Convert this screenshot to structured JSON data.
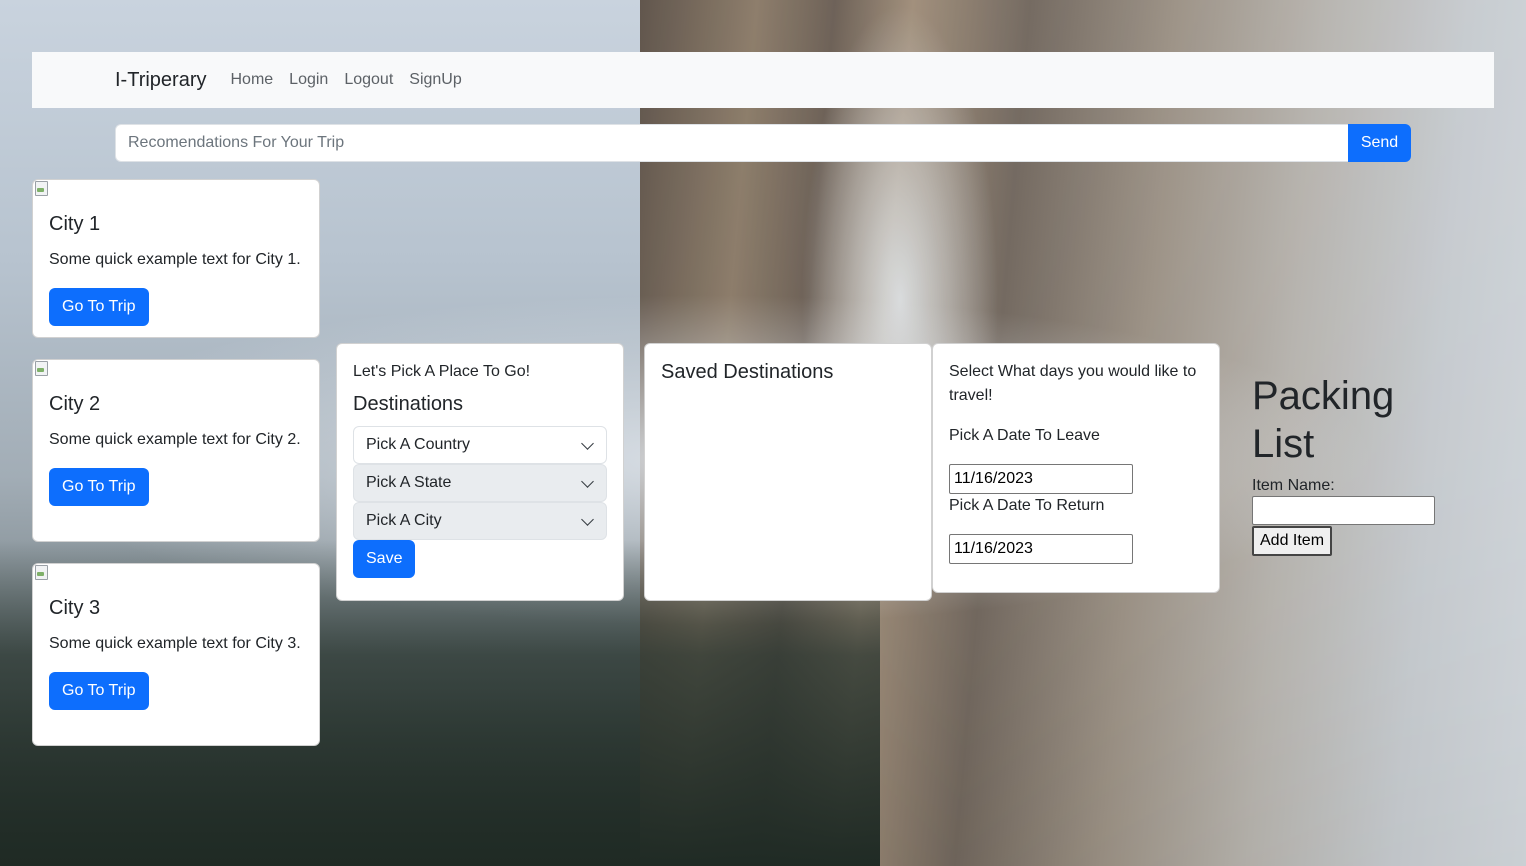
{
  "navbar": {
    "brand": "I-Triperary",
    "links": [
      "Home",
      "Login",
      "Logout",
      "SignUp"
    ]
  },
  "search": {
    "placeholder": "Recomendations For Your Trip",
    "button": "Send"
  },
  "cities": [
    {
      "title": "City 1",
      "text": "Some quick example text for City 1.",
      "button": "Go To Trip"
    },
    {
      "title": "City 2",
      "text": "Some quick example text for City 2.",
      "button": "Go To Trip"
    },
    {
      "title": "City 3",
      "text": "Some quick example text for City 3.",
      "button": "Go To Trip"
    }
  ],
  "destinations": {
    "intro": "Let's Pick A Place To Go!",
    "heading": "Destinations",
    "country": "Pick A Country",
    "state": "Pick A State",
    "city": "Pick A City",
    "save": "Save"
  },
  "saved": {
    "title": "Saved Destinations"
  },
  "dates": {
    "prompt": "Select What days you would like to travel!",
    "leave_label": "Pick A Date To Leave",
    "leave_value": "11/16/2023",
    "return_label": "Pick A Date To Return",
    "return_value": "11/16/2023"
  },
  "packing": {
    "title": "Packing List",
    "item_label": "Item Name:",
    "add_button": "Add Item"
  },
  "colors": {
    "primary": "#0d6efd",
    "navbar_bg": "#f8f9fa"
  }
}
